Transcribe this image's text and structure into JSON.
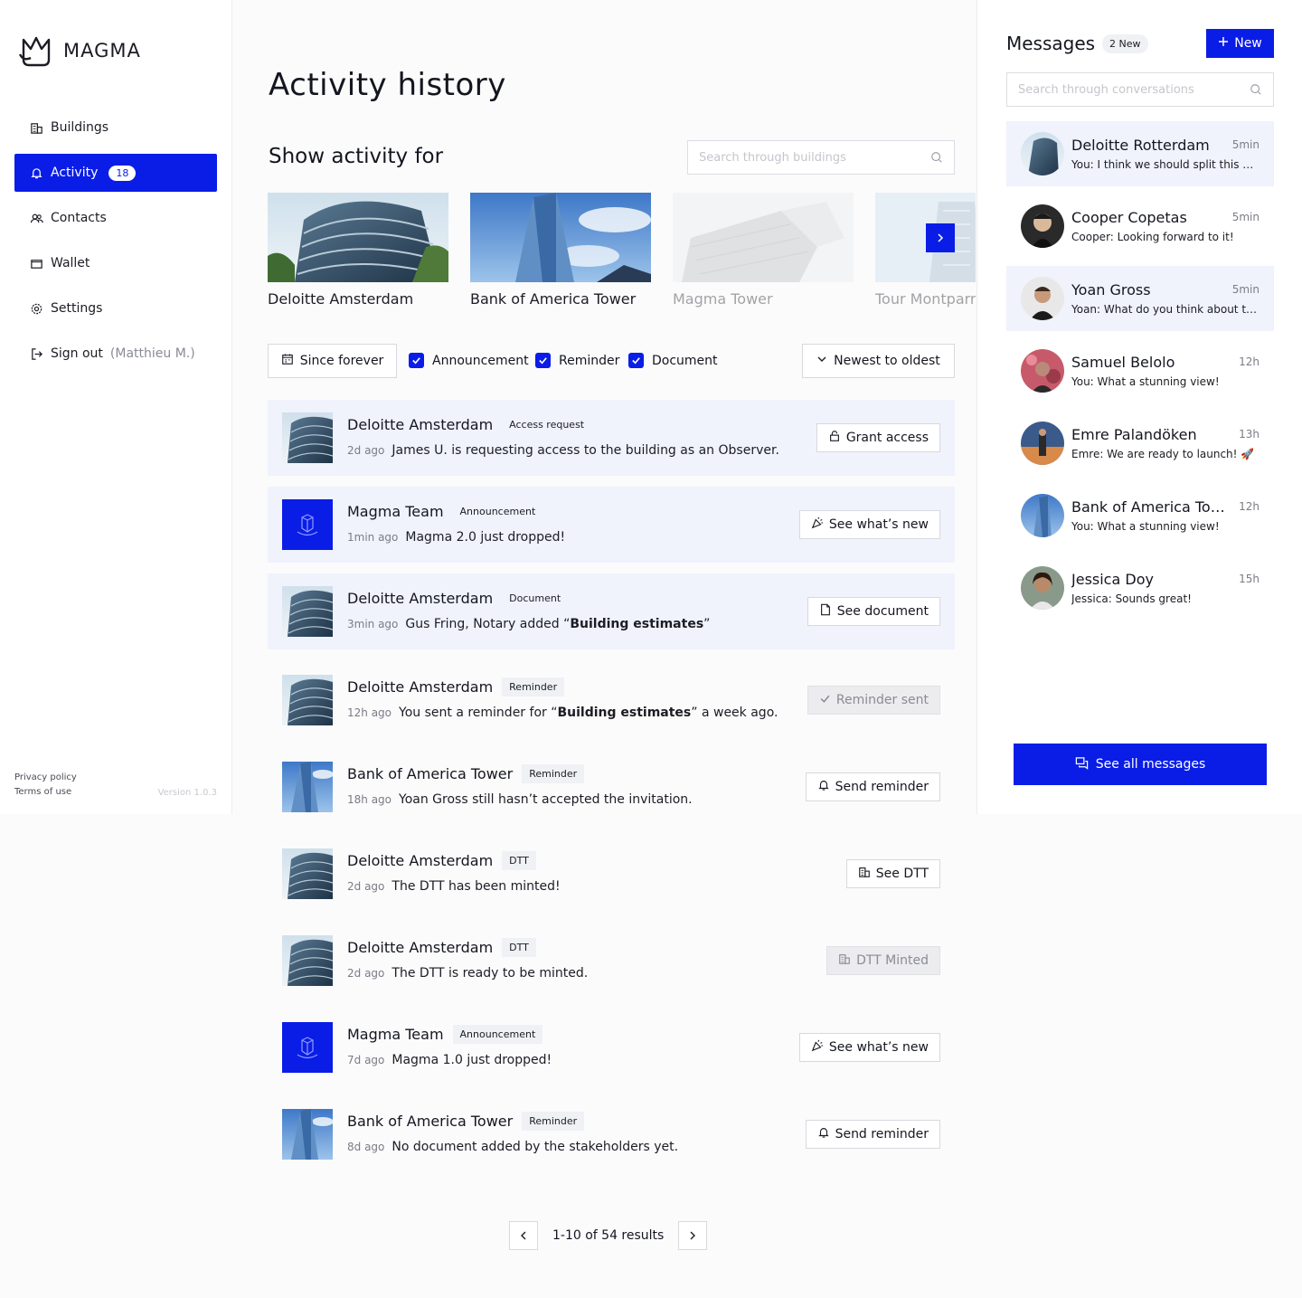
{
  "brand": {
    "name": "MAGMA",
    "accent": "#0a1de6"
  },
  "sidebar": {
    "items": [
      {
        "label": "Buildings",
        "icon": "building-icon"
      },
      {
        "label": "Activity",
        "icon": "bell-icon",
        "badge": "18",
        "active": true
      },
      {
        "label": "Contacts",
        "icon": "users-icon"
      },
      {
        "label": "Wallet",
        "icon": "wallet-icon"
      },
      {
        "label": "Settings",
        "icon": "gear-icon"
      }
    ],
    "signout": {
      "label": "Sign out",
      "user": "(Matthieu M.)"
    },
    "footer": {
      "privacy": "Privacy policy",
      "terms": "Terms of use",
      "version": "Version 1.0.3"
    }
  },
  "main": {
    "title": "Activity history",
    "show_for": "Show activity for",
    "building_search_placeholder": "Search through buildings",
    "buildings": [
      {
        "name": "Deloitte Amsterdam"
      },
      {
        "name": "Bank of America Tower"
      },
      {
        "name": "Magma Tower"
      },
      {
        "name": "Tour Montparnasse"
      }
    ],
    "filters": {
      "date": "Since forever",
      "announcement": "Announcement",
      "reminder": "Reminder",
      "document": "Document",
      "sort": "Newest to oldest"
    },
    "activities": [
      {
        "name": "Deloitte Amsterdam",
        "tag": "Access request",
        "time": "2d ago",
        "text": "James U. is requesting access to the building as an Observer.",
        "action": "Grant access",
        "action_icon": "lock-icon"
      },
      {
        "name": "Magma Team",
        "tag": "Announcement",
        "time": "1min ago",
        "text": "Magma 2.0 just dropped!",
        "action": "See what’s new",
        "action_icon": "party-icon"
      },
      {
        "name": "Deloitte Amsterdam",
        "tag": "Document",
        "time": "3min ago",
        "text_pre": "Gus Fring, Notary added “",
        "text_bold": "Building estimates",
        "text_post": "”",
        "action": "See document",
        "action_icon": "file-icon"
      },
      {
        "name": "Deloitte Amsterdam",
        "tag": "Reminder",
        "time": "12h ago",
        "text_pre": "You sent a reminder for “",
        "text_bold": "Building estimates",
        "text_post": "” a week ago.",
        "action": "Reminder sent",
        "action_icon": "check-icon"
      },
      {
        "name": "Bank of America Tower",
        "tag": "Reminder",
        "time": "18h ago",
        "text": "Yoan Gross still hasn’t accepted the invitation.",
        "action": "Send reminder",
        "action_icon": "bell-icon"
      },
      {
        "name": "Deloitte Amsterdam",
        "tag": "DTT",
        "time": "2d ago",
        "text": "The DTT has been minted!",
        "action": "See DTT",
        "action_icon": "building-icon"
      },
      {
        "name": "Deloitte Amsterdam",
        "tag": "DTT",
        "time": "2d ago",
        "text": "The DTT is ready to be minted.",
        "action": "DTT Minted",
        "action_icon": "building-icon"
      },
      {
        "name": "Magma Team",
        "tag": "Announcement",
        "time": "7d ago",
        "text": "Magma 1.0 just dropped!",
        "action": "See what’s new",
        "action_icon": "party-icon"
      },
      {
        "name": "Bank of America Tower",
        "tag": "Reminder",
        "time": "8d ago",
        "text": "No document added by the stakeholders yet.",
        "action": "Send reminder",
        "action_icon": "bell-icon"
      }
    ],
    "pagination": {
      "text": "1-10 of 54 results"
    }
  },
  "messages": {
    "title": "Messages",
    "count": "2 New",
    "new_button": "New",
    "search_placeholder": "Search through conversations",
    "conversations": [
      {
        "name": "Deloitte Rotterdam",
        "time": "5min",
        "preview": "You: I think we should split this flat"
      },
      {
        "name": "Cooper Copetas",
        "time": "5min",
        "preview": "Cooper: Looking forward to it!"
      },
      {
        "name": "Yoan Gross",
        "time": "5min",
        "preview": "Yoan: What do you think about this?"
      },
      {
        "name": "Samuel Belolo",
        "time": "12h",
        "preview": "You: What a stunning view!"
      },
      {
        "name": "Emre Palandöken",
        "time": "13h",
        "preview": "Emre: We are ready to launch! 🚀"
      },
      {
        "name": "Bank of America Tower",
        "time": "12h",
        "preview": "You: What a stunning view!"
      },
      {
        "name": "Jessica Doy",
        "time": "15h",
        "preview": "Jessica: Sounds great!"
      }
    ],
    "see_all": "See all messages"
  }
}
